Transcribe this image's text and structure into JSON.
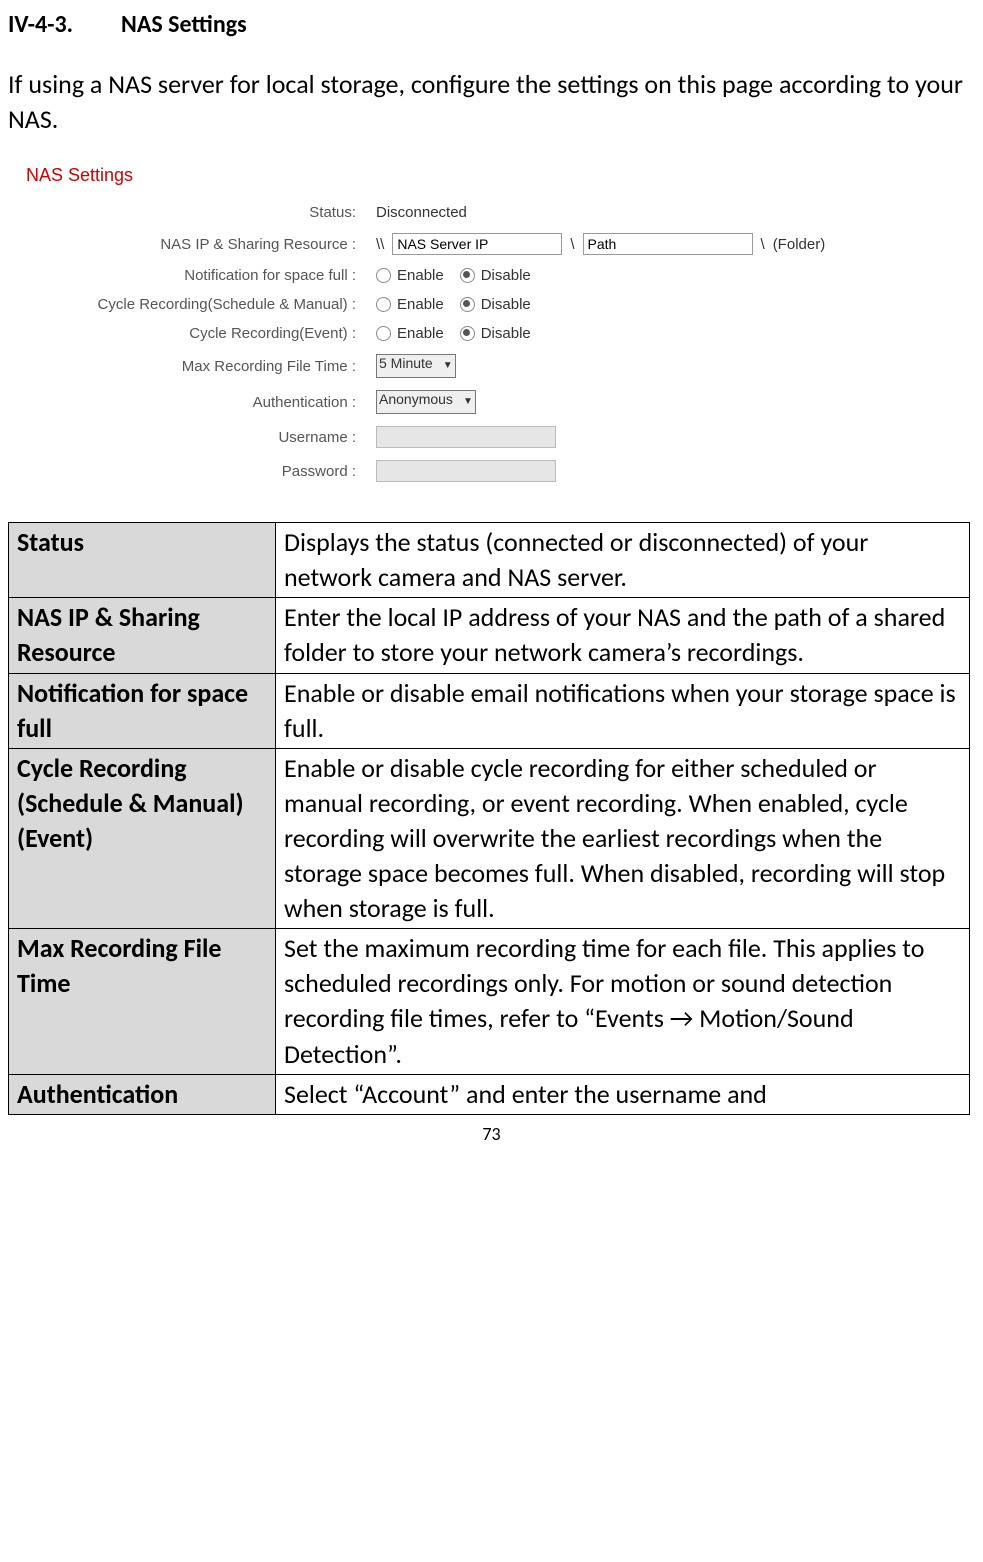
{
  "heading": {
    "num": "IV-4-3.",
    "title": "NAS Settings"
  },
  "intro": "If using a NAS server for local storage, configure the settings on this page according to your NAS.",
  "panel": {
    "title": "NAS Settings",
    "status_label": "Status:",
    "status_value": "Disconnected",
    "ip_label": "NAS IP & Sharing Resource :",
    "ip_prefix": "\\\\",
    "ip_value": "NAS Server IP",
    "ip_sep": "\\",
    "path_value": "Path",
    "folder_sep": "\\",
    "folder_value": "(Folder)",
    "notif_label": "Notification for space full :",
    "cycle_sm_label": "Cycle Recording(Schedule & Manual) :",
    "cycle_ev_label": "Cycle Recording(Event) :",
    "max_time_label": "Max Recording File Time :",
    "max_time_value": "5 Minute",
    "auth_label": "Authentication :",
    "auth_value": "Anonymous",
    "user_label": "Username :",
    "pass_label": "Password :",
    "enable": "Enable",
    "disable": "Disable"
  },
  "table": [
    {
      "term": "Status",
      "desc": "Displays the status (connected or disconnected) of your network camera and NAS server."
    },
    {
      "term": "NAS IP & Sharing Resource",
      "desc": "Enter the local IP address of your NAS and the path of a shared folder to store your network camera’s recordings."
    },
    {
      "term": "Notification for space full",
      "desc": "Enable or disable email notifications when your storage space is full."
    },
    {
      "term": "Cycle Recording (Schedule & Manual) (Event)",
      "desc": "Enable or disable cycle recording for either scheduled or manual recording, or event recording. When enabled, cycle recording will overwrite the earliest recordings when the storage space becomes full. When disabled, recording will stop when storage is full."
    },
    {
      "term": "Max Recording File Time",
      "desc": "Set the maximum recording time for each file. This applies to scheduled recordings only. For motion or sound detection recording file times, refer to “Events → Motion/Sound Detection”."
    },
    {
      "term": "Authentication",
      "desc": "Select “Account” and enter the username and"
    }
  ],
  "page_number": "73"
}
